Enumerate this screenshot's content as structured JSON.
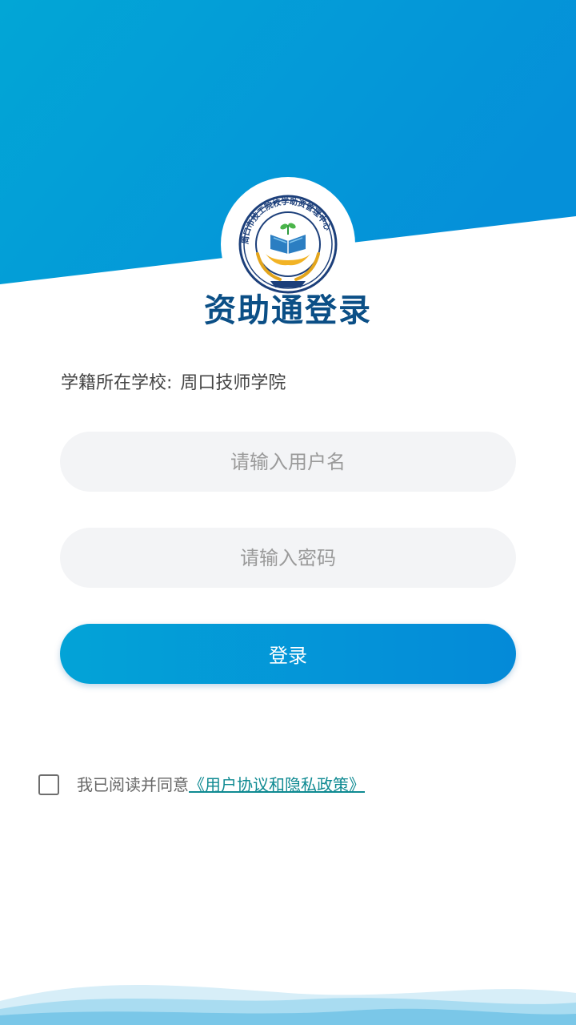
{
  "page": {
    "title": "资助通登录"
  },
  "school": {
    "label": "学籍所在学校:",
    "name": "周口技师学院"
  },
  "logo": {
    "seal_text": "周口市技工院校学助资管理中心"
  },
  "form": {
    "username_placeholder": "请输入用户名",
    "password_placeholder": "请输入密码",
    "login_label": "登录"
  },
  "agreement": {
    "checked": false,
    "prefix": "我已阅读并同意",
    "link_text": "《用户协议和隐私政策》"
  },
  "colors": {
    "header_gradient_start": "#02a6d6",
    "header_gradient_end": "#0590d9",
    "title": "#0b4f86",
    "link": "#0f8a92",
    "input_bg": "#f3f4f6"
  },
  "icons": {
    "logo": "school-seal-emblem",
    "checkbox": "checkbox-unchecked"
  }
}
